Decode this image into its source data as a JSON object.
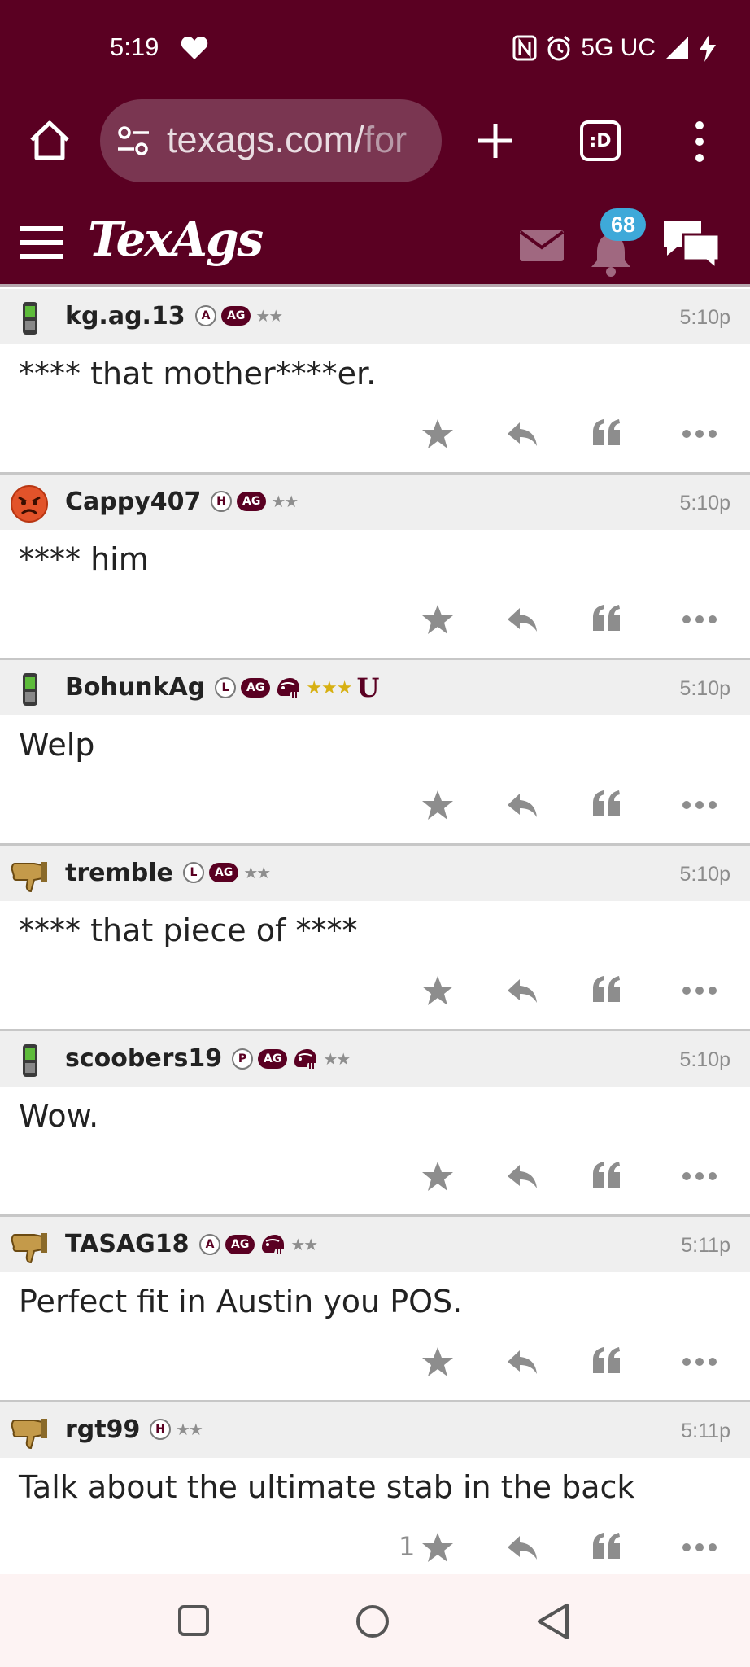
{
  "status_bar": {
    "time": "5:19",
    "network": "5G UC"
  },
  "browser": {
    "url_main": "texags.com/",
    "url_faded": "for"
  },
  "header": {
    "logo": "TexAgs",
    "notification_count": "68"
  },
  "posts": [
    {
      "user": "kg.ag.13",
      "rank": "A",
      "ag": "AG",
      "helmet": false,
      "stars": "★★",
      "gold": false,
      "u": "",
      "time": "5:10p",
      "body": "**** that mother****er.",
      "star_count": "",
      "avatar": "phone-avatar-icon"
    },
    {
      "user": "Cappy407",
      "rank": "H",
      "ag": "AG",
      "helmet": false,
      "stars": "★★",
      "gold": false,
      "u": "",
      "time": "5:10p",
      "body": "**** him",
      "star_count": "",
      "avatar": "angry-face-avatar-icon"
    },
    {
      "user": "BohunkAg",
      "rank": "L",
      "ag": "AG",
      "helmet": true,
      "stars": "★★★",
      "gold": true,
      "u": "U",
      "time": "5:10p",
      "body": "Welp",
      "star_count": "",
      "avatar": "phone-avatar-icon"
    },
    {
      "user": "tremble",
      "rank": "L",
      "ag": "AG",
      "helmet": false,
      "stars": "★★",
      "gold": false,
      "u": "",
      "time": "5:10p",
      "body": "**** that piece of ****",
      "star_count": "",
      "avatar": "thumbs-down-avatar-icon"
    },
    {
      "user": "scoobers19",
      "rank": "P",
      "ag": "AG",
      "helmet": true,
      "stars": "★★",
      "gold": false,
      "u": "",
      "time": "5:10p",
      "body": "Wow.",
      "star_count": "",
      "avatar": "phone-avatar-icon"
    },
    {
      "user": "TASAG18",
      "rank": "A",
      "ag": "AG",
      "helmet": true,
      "stars": "★★",
      "gold": false,
      "u": "",
      "time": "5:11p",
      "body": "Perfect fit in Austin you POS.",
      "star_count": "",
      "avatar": "thumbs-down-avatar-icon"
    },
    {
      "user": "rgt99",
      "rank": "H",
      "ag": "",
      "helmet": false,
      "stars": "★★",
      "gold": false,
      "u": "",
      "time": "5:11p",
      "body": "Talk about the ultimate stab in the back",
      "star_count": "1",
      "avatar": "thumbs-down-avatar-icon"
    }
  ]
}
